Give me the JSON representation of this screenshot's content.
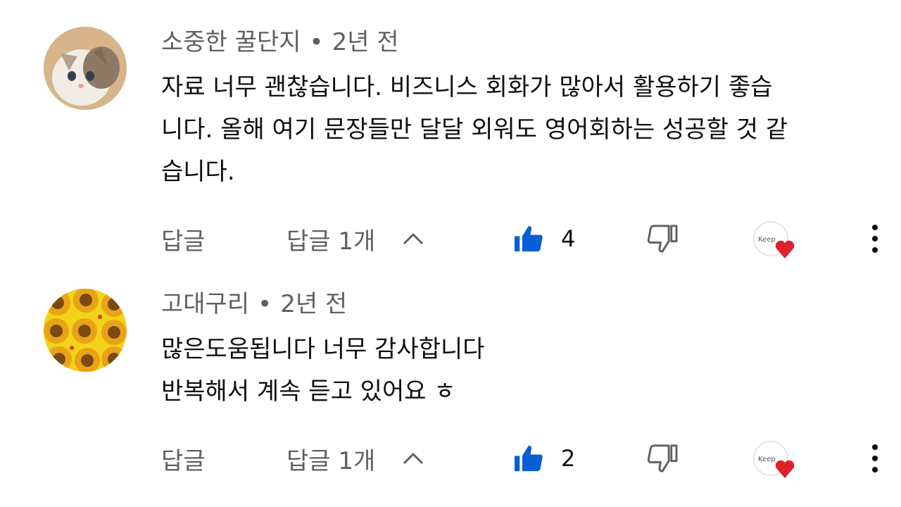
{
  "comments": [
    {
      "author": "소중한 꿀단지",
      "separator": "•",
      "time": "2년 전",
      "avatar_icon": "cat-avatar-icon",
      "text": "자료 너무 괜찮습니다. 비즈니스 회화가 많아서 활용하기 좋습\n니다. 올해 여기 문장들만 달달 외워도 영어회하는 성공할 것 같\n습니다.",
      "reply_label": "답글",
      "replies_label": "답글 1개",
      "like_count": "4",
      "creator_badge": "Keep"
    },
    {
      "author": "고대구리",
      "separator": "•",
      "time": "2년 전",
      "avatar_icon": "sunflower-avatar-icon",
      "text": "많은도움됩니다 너무 감사합니다\n반복해서 계속 듣고 있어요 ㅎ",
      "reply_label": "답글",
      "replies_label": "답글 1개",
      "like_count": "2",
      "creator_badge": "Keep"
    }
  ],
  "colors": {
    "like_blue": "#065fd4",
    "meta_gray": "#606060",
    "heart_red": "#e0202a"
  }
}
